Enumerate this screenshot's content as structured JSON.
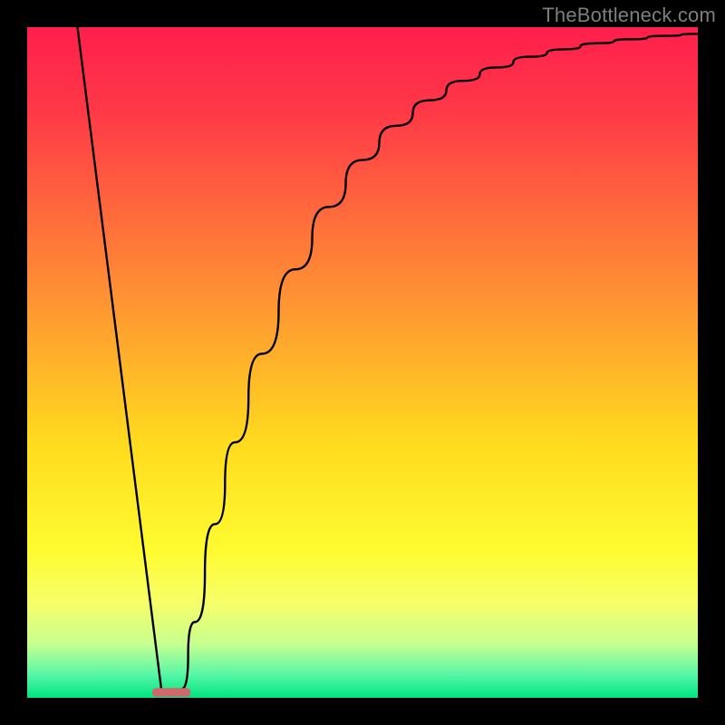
{
  "watermark": "TheBottleneck.com",
  "chart_data": {
    "type": "line",
    "title": "",
    "xlabel": "",
    "ylabel": "",
    "xlim": [
      0,
      100
    ],
    "ylim": [
      0,
      100
    ],
    "grid": false,
    "background": {
      "type": "vertical_gradient",
      "stops": [
        {
          "offset": 0.0,
          "color": "#ff1f4b"
        },
        {
          "offset": 0.12,
          "color": "#ff3748"
        },
        {
          "offset": 0.4,
          "color": "#ff9133"
        },
        {
          "offset": 0.62,
          "color": "#ffdb1e"
        },
        {
          "offset": 0.78,
          "color": "#fffb30"
        },
        {
          "offset": 0.86,
          "color": "#f6ff6a"
        },
        {
          "offset": 0.92,
          "color": "#c6ff8f"
        },
        {
          "offset": 0.965,
          "color": "#58f7a7"
        },
        {
          "offset": 1.0,
          "color": "#00e580"
        }
      ]
    },
    "series": [
      {
        "name": "left_arm",
        "comment": "Straight descending segment from top-left to notch",
        "type": "line",
        "color": "#000000",
        "x": [
          7.5,
          20.0
        ],
        "y": [
          100.0,
          1.3
        ]
      },
      {
        "name": "right_arm",
        "comment": "Rising saturating curve from notch to right edge; y ~ 100*(1-exp(-(x-23)/16.7)) clipped above 0, reaching ~90 at x=60 and ~99 at x=100",
        "type": "line",
        "color": "#000000",
        "x": [
          23.0,
          25,
          28,
          31,
          35,
          40,
          45,
          50,
          55,
          60,
          65,
          70,
          75,
          80,
          85,
          90,
          95,
          100
        ],
        "y": [
          1.3,
          11.3,
          25.9,
          38.1,
          51.3,
          63.9,
          73.2,
          80.2,
          85.3,
          89.1,
          92.0,
          94.0,
          95.6,
          96.7,
          97.6,
          98.2,
          98.7,
          99.0
        ]
      }
    ],
    "marker": {
      "comment": "Flat pink lozenge at the notch base",
      "x_center": 21.5,
      "y": 0.8,
      "width": 5.7,
      "height": 1.3,
      "color": "#d1686c",
      "rx": 4
    }
  }
}
